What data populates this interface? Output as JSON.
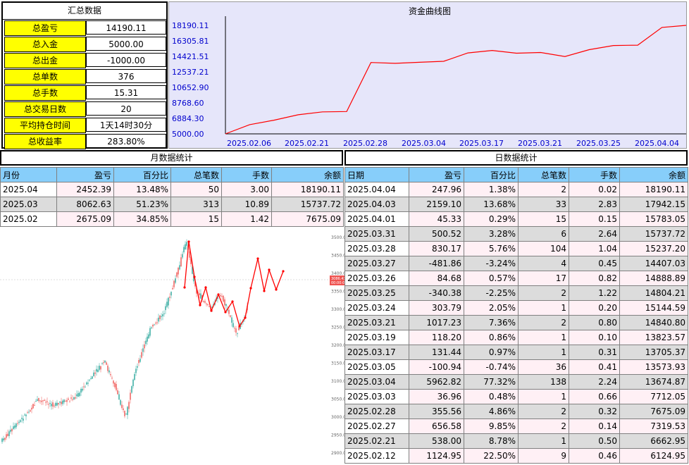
{
  "summary": {
    "title": "汇总数据",
    "rows": [
      {
        "label": "总盈亏",
        "value": "14190.11"
      },
      {
        "label": "总入金",
        "value": "5000.00"
      },
      {
        "label": "总出金",
        "value": "-1000.00"
      },
      {
        "label": "总单数",
        "value": "376"
      },
      {
        "label": "总手数",
        "value": "15.31"
      },
      {
        "label": "总交易日数",
        "value": "20"
      },
      {
        "label": "平均持仓时间",
        "value": "1天14时30分"
      },
      {
        "label": "总收益率",
        "value": "283.80%"
      }
    ]
  },
  "curve": {
    "title": "资金曲线图",
    "y_ticks": [
      "18190.11",
      "16305.81",
      "14421.51",
      "12537.21",
      "10652.90",
      "8768.60",
      "6884.30",
      "5000.00"
    ],
    "x_ticks": [
      "2025.02.06",
      "2025.02.21",
      "2025.02.28",
      "2025.03.04",
      "2025.03.17",
      "2025.03.21",
      "2025.03.25",
      "2025.04.04"
    ],
    "ylim": [
      5000.0,
      18190.11
    ],
    "points": [
      5000,
      6124.95,
      6662.95,
      7319.53,
      7675.09,
      7712.05,
      13674.87,
      13573.93,
      13705.37,
      13823.57,
      14840.8,
      15144.59,
      14804.21,
      14888.89,
      14407.03,
      15237.2,
      15737.72,
      15783.05,
      17942.15,
      18190.11
    ],
    "line_color": "#ff0000",
    "bg_color": "#e6e6fa"
  },
  "monthly": {
    "title": "月数据统计",
    "headers": [
      "月份",
      "盈亏",
      "百分比",
      "总笔数",
      "手数",
      "余额"
    ],
    "rows": [
      [
        "2025.04",
        "2452.39",
        "13.48%",
        "50",
        "3.00",
        "18190.11"
      ],
      [
        "2025.03",
        "8062.63",
        "51.23%",
        "313",
        "10.89",
        "15737.72"
      ],
      [
        "2025.02",
        "2675.09",
        "34.85%",
        "15",
        "1.42",
        "7675.09"
      ]
    ]
  },
  "daily": {
    "title": "日数据统计",
    "headers": [
      "日期",
      "盈亏",
      "百分比",
      "总笔数",
      "手数",
      "余额"
    ],
    "rows": [
      [
        "2025.04.04",
        "247.96",
        "1.38%",
        "2",
        "0.02",
        "18190.11"
      ],
      [
        "2025.04.03",
        "2159.10",
        "13.68%",
        "33",
        "2.83",
        "17942.15"
      ],
      [
        "2025.04.01",
        "45.33",
        "0.29%",
        "15",
        "0.15",
        "15783.05"
      ],
      [
        "2025.03.31",
        "500.52",
        "3.28%",
        "6",
        "2.64",
        "15737.72"
      ],
      [
        "2025.03.28",
        "830.17",
        "5.76%",
        "104",
        "1.04",
        "15237.20"
      ],
      [
        "2025.03.27",
        "-481.86",
        "-3.24%",
        "4",
        "0.45",
        "14407.03"
      ],
      [
        "2025.03.26",
        "84.68",
        "0.57%",
        "17",
        "0.82",
        "14888.89"
      ],
      [
        "2025.03.25",
        "-340.38",
        "-2.25%",
        "2",
        "1.22",
        "14804.21"
      ],
      [
        "2025.03.24",
        "303.79",
        "2.05%",
        "1",
        "0.20",
        "15144.59"
      ],
      [
        "2025.03.21",
        "1017.23",
        "7.36%",
        "2",
        "0.80",
        "14840.80"
      ],
      [
        "2025.03.19",
        "118.20",
        "0.86%",
        "1",
        "0.10",
        "13823.57"
      ],
      [
        "2025.03.17",
        "131.44",
        "0.97%",
        "1",
        "0.31",
        "13705.37"
      ],
      [
        "2025.03.05",
        "-100.94",
        "-0.74%",
        "36",
        "0.41",
        "13573.93"
      ],
      [
        "2025.03.04",
        "5962.82",
        "77.32%",
        "138",
        "2.24",
        "13674.87"
      ],
      [
        "2025.03.03",
        "36.96",
        "0.48%",
        "1",
        "0.66",
        "7712.05"
      ],
      [
        "2025.02.28",
        "355.56",
        "4.86%",
        "2",
        "0.32",
        "7675.09"
      ],
      [
        "2025.02.27",
        "656.58",
        "9.85%",
        "2",
        "0.14",
        "7319.53"
      ],
      [
        "2025.02.21",
        "538.00",
        "8.78%",
        "1",
        "0.50",
        "6662.95"
      ],
      [
        "2025.02.12",
        "1124.95",
        "22.50%",
        "9",
        "0.46",
        "6124.95"
      ]
    ]
  },
  "overlay_chart": {
    "price_tag": [
      "3086.43",
      "00:00:0"
    ],
    "y_ticks": [
      "3500.00",
      "3450.00",
      "3400.00",
      "3350.00",
      "3300.00",
      "3250.00",
      "3200.00",
      "3150.00",
      "3100.00",
      "3050.00",
      "3000.00",
      "2950.00",
      "2900.00"
    ],
    "up_color": "#26a69a",
    "down_color": "#ef5350",
    "arrow_color": "#ff0000"
  }
}
